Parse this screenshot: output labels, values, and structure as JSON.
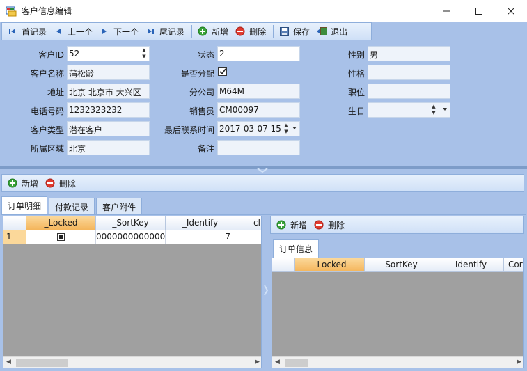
{
  "window": {
    "title": "客户信息编辑"
  },
  "toolbar": {
    "first": "首记录",
    "prev": "上一个",
    "next": "下一个",
    "last": "尾记录",
    "add": "新增",
    "delete": "删除",
    "save": "保存",
    "exit": "退出"
  },
  "form": {
    "customer_id_label": "客户ID",
    "customer_id": "52",
    "customer_name_label": "客户名称",
    "customer_name": "蒲松龄",
    "address_label": "地址",
    "address": "北京 北京市 大兴区",
    "phone_label": "电话号码",
    "phone": "1232323232",
    "customer_type_label": "客户类型",
    "customer_type": "潜在客户",
    "region_label": "所属区域",
    "region": "北京",
    "status_label": "状态",
    "status": "2",
    "assigned_label": "是否分配",
    "branch_label": "分公司",
    "branch": "M64M",
    "salesman_label": "销售员",
    "salesman": "CM00097",
    "last_contact_label": "最后联系时间",
    "last_contact": "2017-03-07 15",
    "remark_label": "备注",
    "remark": "",
    "gender_label": "性别",
    "gender": "男",
    "personality_label": "性格",
    "personality": "",
    "position_label": "职位",
    "position": "",
    "birthday_label": "生日",
    "birthday": ""
  },
  "detail_toolbar": {
    "add": "新增",
    "delete": "删除"
  },
  "tabs": [
    "订单明细",
    "付款记录",
    "客户附件"
  ],
  "left_grid": {
    "columns": [
      "_Locked",
      "_SortKey",
      "_Identify",
      "cl"
    ],
    "rows": [
      {
        "rownum": "1",
        "sortkey": "0000000000000",
        "identify": "7"
      }
    ]
  },
  "right_panel": {
    "toolbar": {
      "add": "新增",
      "delete": "删除"
    },
    "tab": "订单信息",
    "columns": [
      "_Locked",
      "_SortKey",
      "_Identify",
      "Cor"
    ]
  },
  "colors": {
    "accent": "#a8c1e8",
    "selected_header": "#f4b55b"
  }
}
